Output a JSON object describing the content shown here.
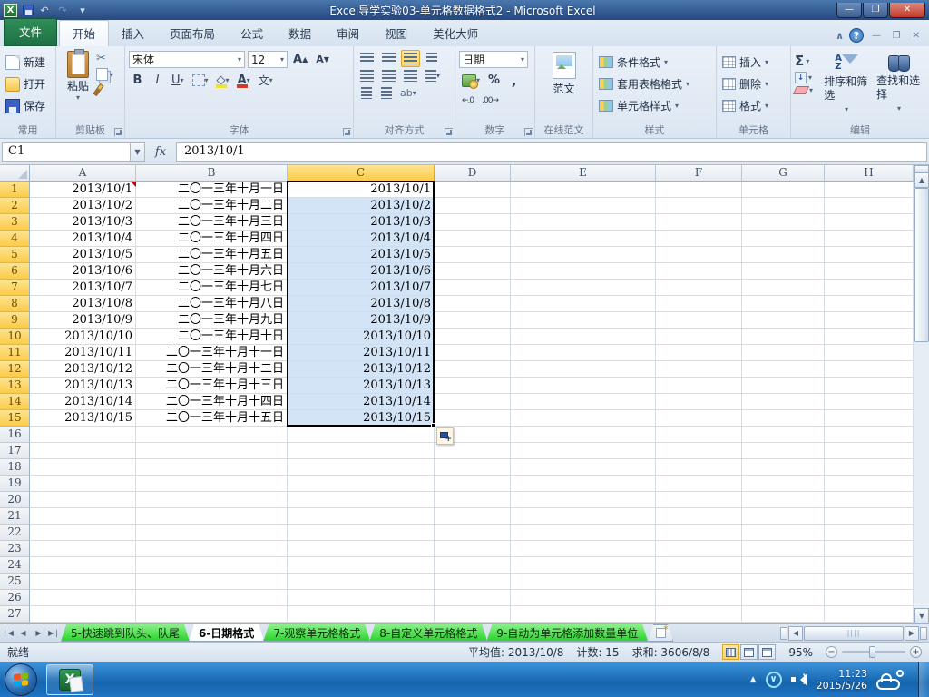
{
  "titlebar": {
    "title": "Excel导学实验03-单元格数据格式2 - Microsoft Excel"
  },
  "ribbon_tabs": [
    "文件",
    "开始",
    "插入",
    "页面布局",
    "公式",
    "数据",
    "审阅",
    "视图",
    "美化大师"
  ],
  "active_tab": "开始",
  "ribbon": {
    "common": {
      "label": "常用",
      "new": "新建",
      "open": "打开",
      "save": "保存"
    },
    "clipboard": {
      "label": "剪贴板",
      "paste": "粘贴"
    },
    "font": {
      "label": "字体",
      "font_name": "宋体",
      "font_size": "12",
      "bold": "B",
      "italic": "I",
      "underline": "U",
      "wen": "文",
      "grow": "A",
      "shrink": "A",
      "color_a": "A"
    },
    "alignment": {
      "label": "对齐方式"
    },
    "number": {
      "label": "数字",
      "format": "日期",
      "percent": "%",
      "comma": ",",
      "dec_left": ".0",
      "dec_right": ".00"
    },
    "online": {
      "label": "在线范文",
      "fanwen": "范文"
    },
    "styles": {
      "label": "样式",
      "items": [
        "条件格式",
        "套用表格格式",
        "单元格样式"
      ]
    },
    "cells": {
      "label": "单元格",
      "items": [
        "插入",
        "删除",
        "格式"
      ]
    },
    "editing": {
      "label": "编辑",
      "sigma": "Σ",
      "sort": "排序和筛选",
      "find": "查找和选择"
    }
  },
  "formula_bar": {
    "name_box": "C1",
    "fx": "fx",
    "value": "2013/10/1"
  },
  "grid": {
    "columns": [
      "A",
      "B",
      "C",
      "D",
      "E",
      "F",
      "G",
      "H"
    ],
    "selected_column": "C",
    "selection": "C1:C15",
    "row_count": 27,
    "rows": [
      {
        "a": "2013/10/1",
        "b": "二〇一三年十月一日",
        "c": "2013/10/1"
      },
      {
        "a": "2013/10/2",
        "b": "二〇一三年十月二日",
        "c": "2013/10/2"
      },
      {
        "a": "2013/10/3",
        "b": "二〇一三年十月三日",
        "c": "2013/10/3"
      },
      {
        "a": "2013/10/4",
        "b": "二〇一三年十月四日",
        "c": "2013/10/4"
      },
      {
        "a": "2013/10/5",
        "b": "二〇一三年十月五日",
        "c": "2013/10/5"
      },
      {
        "a": "2013/10/6",
        "b": "二〇一三年十月六日",
        "c": "2013/10/6"
      },
      {
        "a": "2013/10/7",
        "b": "二〇一三年十月七日",
        "c": "2013/10/7"
      },
      {
        "a": "2013/10/8",
        "b": "二〇一三年十月八日",
        "c": "2013/10/8"
      },
      {
        "a": "2013/10/9",
        "b": "二〇一三年十月九日",
        "c": "2013/10/9"
      },
      {
        "a": "2013/10/10",
        "b": "二〇一三年十月十日",
        "c": "2013/10/10"
      },
      {
        "a": "2013/10/11",
        "b": "二〇一三年十月十一日",
        "c": "2013/10/11"
      },
      {
        "a": "2013/10/12",
        "b": "二〇一三年十月十二日",
        "c": "2013/10/12"
      },
      {
        "a": "2013/10/13",
        "b": "二〇一三年十月十三日",
        "c": "2013/10/13"
      },
      {
        "a": "2013/10/14",
        "b": "二〇一三年十月十四日",
        "c": "2013/10/14"
      },
      {
        "a": "2013/10/15",
        "b": "二〇一三年十月十五日",
        "c": "2013/10/15"
      }
    ]
  },
  "sheet_tabs": [
    {
      "label": "5-快速跳到队头、队尾",
      "active": false
    },
    {
      "label": "6-日期格式",
      "active": true
    },
    {
      "label": "7-观察单元格格式",
      "active": false
    },
    {
      "label": "8-自定义单元格格式",
      "active": false
    },
    {
      "label": "9-自动为单元格添加数量单位",
      "active": false
    }
  ],
  "status_bar": {
    "mode": "就绪",
    "average": "平均值: 2013/10/8",
    "count": "计数: 15",
    "sum": "求和: 3606/8/8",
    "zoom": "95%"
  },
  "taskbar": {
    "time": "11:23",
    "date": "2015/5/26"
  },
  "colors": {
    "accent_selection": "#d2e4f6",
    "selected_header": "#fbcb4a",
    "sheet_tab_green": "#2bd42b",
    "file_tab_green": "#1e7145"
  }
}
